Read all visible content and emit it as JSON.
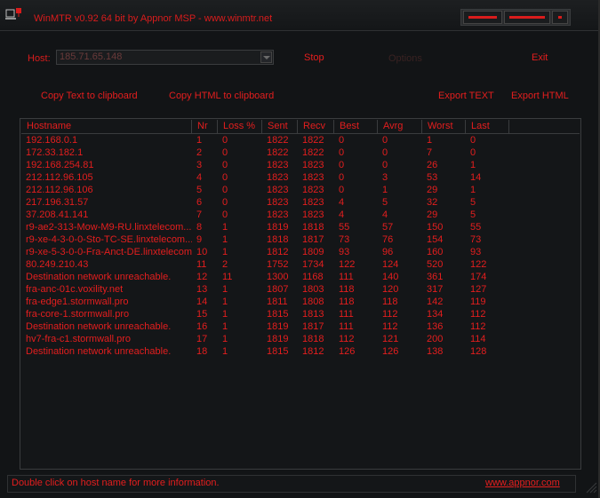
{
  "window": {
    "title": "WinMTR v0.92 64 bit by Appnor MSP - www.winmtr.net"
  },
  "toolbar": {
    "host_label": "Host:",
    "host_value": "185.71.65.148",
    "stop_label": "Stop",
    "options_label": "Options",
    "exit_label": "Exit",
    "copy_text_label": "Copy Text to clipboard",
    "copy_html_label": "Copy HTML to clipboard",
    "export_text_label": "Export TEXT",
    "export_html_label": "Export HTML"
  },
  "table": {
    "columns": [
      "Hostname",
      "Nr",
      "Loss %",
      "Sent",
      "Recv",
      "Best",
      "Avrg",
      "Worst",
      "Last"
    ],
    "rows": [
      [
        "192.168.0.1",
        "1",
        "0",
        "1822",
        "1822",
        "0",
        "0",
        "1",
        "0"
      ],
      [
        "172.33.182.1",
        "2",
        "0",
        "1822",
        "1822",
        "0",
        "0",
        "7",
        "0"
      ],
      [
        "192.168.254.81",
        "3",
        "0",
        "1823",
        "1823",
        "0",
        "0",
        "26",
        "1"
      ],
      [
        "212.112.96.105",
        "4",
        "0",
        "1823",
        "1823",
        "0",
        "3",
        "53",
        "14"
      ],
      [
        "212.112.96.106",
        "5",
        "0",
        "1823",
        "1823",
        "0",
        "1",
        "29",
        "1"
      ],
      [
        "217.196.31.57",
        "6",
        "0",
        "1823",
        "1823",
        "4",
        "5",
        "32",
        "5"
      ],
      [
        "37.208.41.141",
        "7",
        "0",
        "1823",
        "1823",
        "4",
        "4",
        "29",
        "5"
      ],
      [
        "r9-ae2-313-Mow-M9-RU.linxtelecom....",
        "8",
        "1",
        "1819",
        "1818",
        "55",
        "57",
        "150",
        "55"
      ],
      [
        "r9-xe-4-3-0-0-Sto-TC-SE.linxtelecom....",
        "9",
        "1",
        "1818",
        "1817",
        "73",
        "76",
        "154",
        "73"
      ],
      [
        "r9-xe-5-3-0-0-Fra-Anct-DE.linxtelecom...",
        "10",
        "1",
        "1812",
        "1809",
        "93",
        "96",
        "160",
        "93"
      ],
      [
        "80.249.210.43",
        "11",
        "2",
        "1752",
        "1734",
        "122",
        "124",
        "520",
        "122"
      ],
      [
        "Destination network unreachable.",
        "12",
        "11",
        "1300",
        "1168",
        "111",
        "140",
        "361",
        "174"
      ],
      [
        "fra-anc-01c.voxility.net",
        "13",
        "1",
        "1807",
        "1803",
        "118",
        "120",
        "317",
        "127"
      ],
      [
        "fra-edge1.stormwall.pro",
        "14",
        "1",
        "1811",
        "1808",
        "118",
        "118",
        "142",
        "119"
      ],
      [
        "fra-core-1.stormwall.pro",
        "15",
        "1",
        "1815",
        "1813",
        "111",
        "112",
        "134",
        "112"
      ],
      [
        "Destination network unreachable.",
        "16",
        "1",
        "1819",
        "1817",
        "111",
        "112",
        "136",
        "112"
      ],
      [
        "hv7-fra-c1.stormwall.pro",
        "17",
        "1",
        "1819",
        "1818",
        "112",
        "121",
        "200",
        "114"
      ],
      [
        "Destination network unreachable.",
        "18",
        "1",
        "1815",
        "1812",
        "126",
        "126",
        "138",
        "128"
      ]
    ]
  },
  "status": {
    "message": "Double click on host name for more information.",
    "link": "www.appnor.com"
  },
  "colors": {
    "accent": "#e41e1e",
    "background": "#121416",
    "border": "#3a3c3e"
  }
}
